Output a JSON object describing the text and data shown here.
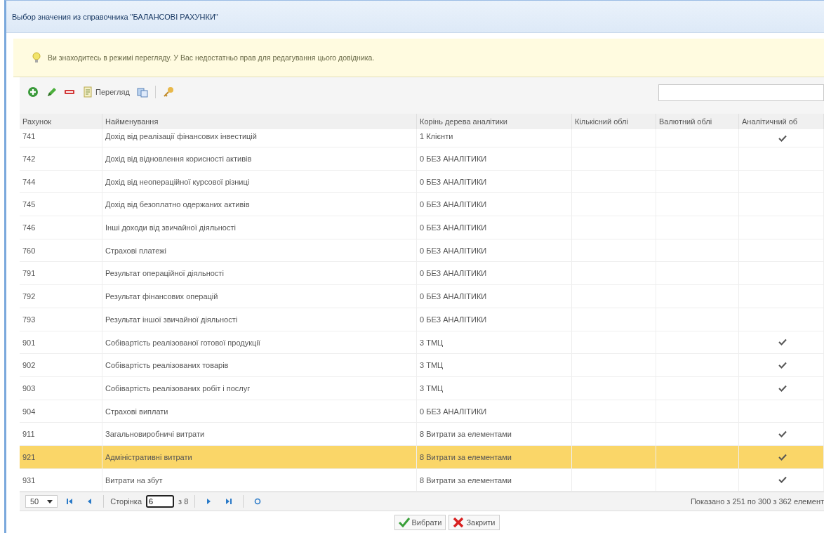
{
  "window": {
    "title": "Выбор значения из справочника \"БАЛАНСОВІ РАХУНКИ\""
  },
  "notice": "Ви знаходитесь в режимі перегляду. У Вас недостатньо прав для редагування цього довідника.",
  "toolbar": [
    {
      "kind": "add"
    },
    {
      "kind": "edit"
    },
    {
      "kind": "delete"
    },
    {
      "kind": "view",
      "label": "Перегляд"
    },
    {
      "kind": "copy"
    },
    {
      "kind": "key"
    }
  ],
  "table": {
    "columns": [
      "Рахунок",
      "Найменування",
      "Корінь дерева аналітики",
      "Кількісний облі",
      "Валютний облі",
      "Аналітичний об"
    ],
    "rows": [
      {
        "account": "741",
        "name": "Дохід від реалізації фінансових інвестицій",
        "root": "1 Клієнти",
        "analytic": true,
        "selected": false
      },
      {
        "account": "742",
        "name": "Дохід від відновлення корисності активів",
        "root": "0 БЕЗ АНАЛІТИКИ",
        "analytic": false,
        "selected": false
      },
      {
        "account": "744",
        "name": "Дохід від неопераційної курсової різниці",
        "root": "0 БЕЗ АНАЛІТИКИ",
        "analytic": false,
        "selected": false
      },
      {
        "account": "745",
        "name": "Дохід від безоплатно одержаних активів",
        "root": "0 БЕЗ АНАЛІТИКИ",
        "analytic": false,
        "selected": false
      },
      {
        "account": "746",
        "name": "Інші доходи від звичайної діяльності",
        "root": "0 БЕЗ АНАЛІТИКИ",
        "analytic": false,
        "selected": false
      },
      {
        "account": "760",
        "name": "Страхові платежі",
        "root": "0 БЕЗ АНАЛІТИКИ",
        "analytic": false,
        "selected": false
      },
      {
        "account": "791",
        "name": "Результат операційної діяльності",
        "root": "0 БЕЗ АНАЛІТИКИ",
        "analytic": false,
        "selected": false
      },
      {
        "account": "792",
        "name": "Результат фінансових операцій",
        "root": "0 БЕЗ АНАЛІТИКИ",
        "analytic": false,
        "selected": false
      },
      {
        "account": "793",
        "name": "Результат іншої звичайної діяльності",
        "root": "0 БЕЗ АНАЛІТИКИ",
        "analytic": false,
        "selected": false
      },
      {
        "account": "901",
        "name": "Собівартість реалізованої готової продукції",
        "root": "3 ТМЦ",
        "analytic": true,
        "selected": false
      },
      {
        "account": "902",
        "name": "Собівартість реалізованих товарів",
        "root": "3 ТМЦ",
        "analytic": true,
        "selected": false
      },
      {
        "account": "903",
        "name": "Собівартість реалізованих робіт і послуг",
        "root": "3 ТМЦ",
        "analytic": true,
        "selected": false
      },
      {
        "account": "904",
        "name": "Страхові виплати",
        "root": "0 БЕЗ АНАЛІТИКИ",
        "analytic": false,
        "selected": false
      },
      {
        "account": "911",
        "name": "Загальновиробничі витрати",
        "root": "8 Витрати за елементами",
        "analytic": true,
        "selected": false
      },
      {
        "account": "921",
        "name": "Адміністративні витрати",
        "root": "8 Витрати за елементами",
        "analytic": true,
        "selected": true
      },
      {
        "account": "931",
        "name": "Витрати на збут",
        "root": "8 Витрати за елементами",
        "analytic": true,
        "selected": false
      }
    ]
  },
  "pager": {
    "page_size": "50",
    "page_label": "Сторінка",
    "page": "6",
    "of": "з 8",
    "summary": "Показано з 251 по 300 з 362 елемент"
  },
  "buttons": [
    {
      "kind": "ok",
      "label": "Вибрати"
    },
    {
      "kind": "close",
      "label": "Закрити"
    }
  ]
}
